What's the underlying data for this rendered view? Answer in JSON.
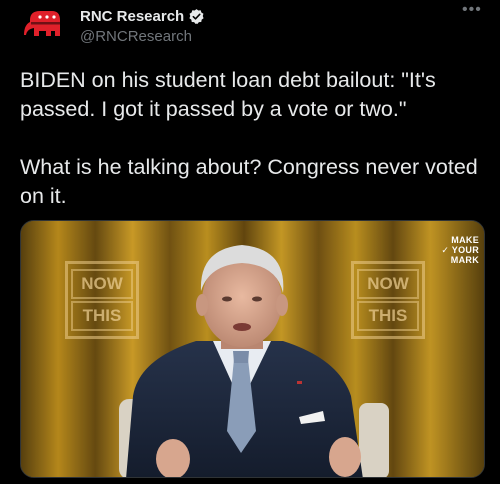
{
  "account": {
    "display_name": "RNC Research",
    "handle": "@RNCResearch",
    "avatar_icon": "gop-elephant-icon",
    "verified_icon": "verified-badge-icon",
    "more_icon": "more-options-icon"
  },
  "tweet": {
    "paragraph_1": "BIDEN on his student loan debt bailout: \"It's passed. I got it passed by a vote or two.\"",
    "paragraph_2": "What is he talking about? Congress never voted on it."
  },
  "media": {
    "type": "video-thumbnail",
    "sign_left": [
      "NOW",
      "THIS"
    ],
    "sign_right": [
      "NOW",
      "THIS"
    ],
    "watermark": [
      "MAKE",
      "✓ YOUR",
      "MARK"
    ]
  },
  "colors": {
    "background": "#000000",
    "text": "#e7e9ea",
    "secondary_text": "#71767b",
    "verified": "#1d9bf0",
    "avatar_red": "#e0202a"
  }
}
